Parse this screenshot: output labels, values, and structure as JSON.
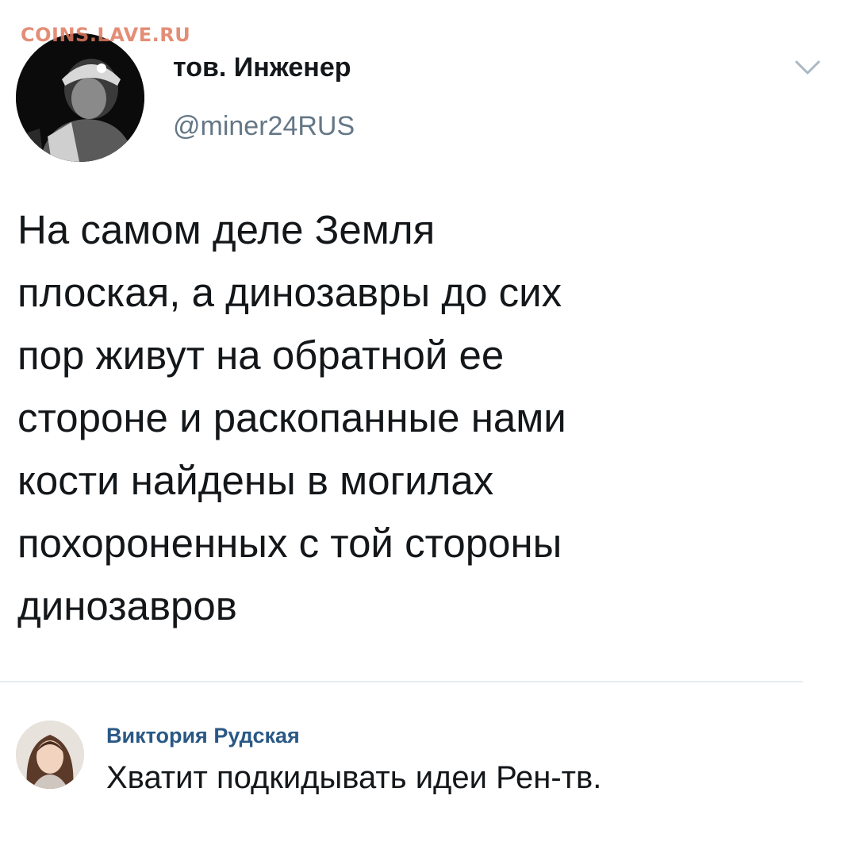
{
  "watermark": "COINS.LAVE.RU",
  "tweet": {
    "display_name": "тов. Инженер",
    "handle": "@miner24RUS",
    "text_lines": [
      "На самом деле Земля",
      "плоская, а динозавры до сих",
      "пор живут на обратной ее",
      "стороне и раскопанные нами",
      "кости найдены в могилах",
      "похороненных с той стороны",
      "динозавров"
    ],
    "menu_icon": "chevron-down-icon"
  },
  "comment": {
    "author": "Виктория Рудская",
    "text": "Хватит подкидывать идеи Рен-тв."
  },
  "colors": {
    "text": "#14171a",
    "handle": "#657786",
    "comment_author": "#2a5885",
    "watermark": "#e07a5f",
    "divider": "#e6ecf0"
  }
}
